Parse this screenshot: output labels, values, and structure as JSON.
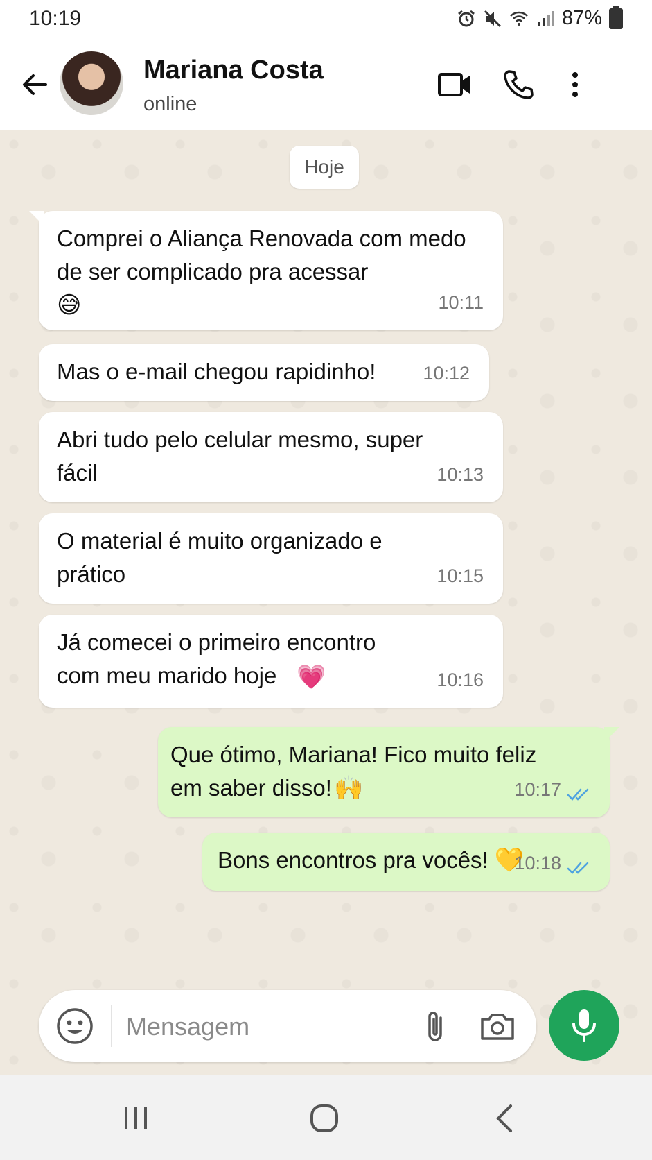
{
  "status_bar": {
    "time": "10:19",
    "battery_percent": "87%",
    "icons": [
      "alarm-icon",
      "mute-icon",
      "wifi-icon",
      "signal-icon",
      "battery-icon"
    ]
  },
  "header": {
    "contact_name": "Mariana Costa",
    "contact_status": "online",
    "icons": [
      "back-arrow-icon",
      "video-call-icon",
      "phone-icon",
      "more-vertical-icon"
    ]
  },
  "chat": {
    "date_label": "Hoje",
    "messages": [
      {
        "direction": "in",
        "text": "Comprei o Aliança Renovada com medo de ser complicado pra acessar",
        "emoji": "😅",
        "time": "10:11"
      },
      {
        "direction": "in",
        "text": "Mas o e-mail chegou rapidinho!",
        "time": "10:12"
      },
      {
        "direction": "in",
        "text": "Abri tudo pelo celular mesmo, super fácil",
        "time": "10:13"
      },
      {
        "direction": "in",
        "text": "O material é muito organizado e prático",
        "time": "10:15"
      },
      {
        "direction": "in",
        "text": "Já comecei o primeiro encontro com meu marido hoje",
        "emoji": "💗",
        "time": "10:16"
      },
      {
        "direction": "out",
        "text": "Que ótimo, Mariana! Fico muito feliz em saber disso!",
        "emoji": "🙌",
        "time": "10:17",
        "status": "read"
      },
      {
        "direction": "out",
        "text": "Bons encontros pra vocês!",
        "emoji": "💛",
        "time": "10:18",
        "status": "read"
      }
    ]
  },
  "composer": {
    "placeholder": "Mensagem",
    "value": "",
    "icons": [
      "emoji-icon",
      "attach-icon",
      "camera-icon",
      "mic-icon"
    ]
  },
  "colors": {
    "incoming_bubble": "#ffffff",
    "outgoing_bubble": "#dcf8c6",
    "accent_green": "#1fa45a",
    "read_ticks": "#4fa3e0",
    "chat_background": "#efe9df"
  },
  "nav_bar": {
    "icons": [
      "recent-apps-icon",
      "home-icon",
      "back-icon"
    ]
  }
}
